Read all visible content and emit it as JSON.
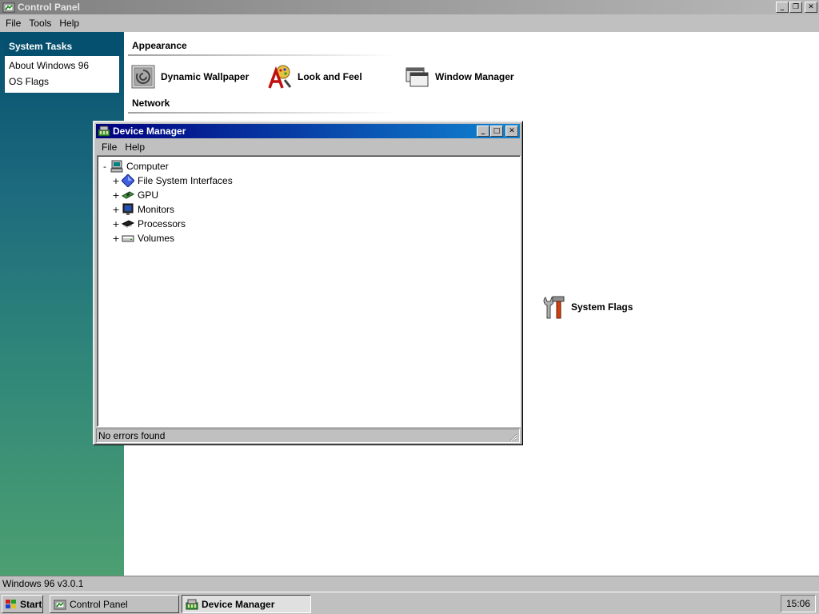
{
  "control_panel": {
    "title": "Control Panel",
    "menu": [
      "File",
      "Tools",
      "Help"
    ],
    "title_buttons": {
      "minimize": "_",
      "restore": "❐",
      "close": "✕"
    },
    "status_text": "Windows 96 v3.0.1"
  },
  "sidebar": {
    "header": "System Tasks",
    "items": [
      {
        "label": "About Windows 96"
      },
      {
        "label": "OS Flags"
      }
    ]
  },
  "sections": {
    "appearance": {
      "heading": "Appearance",
      "applets": [
        {
          "label": "Dynamic Wallpaper",
          "icon": "wallpaper-icon"
        },
        {
          "label": "Look and Feel",
          "icon": "look-and-feel-icon"
        },
        {
          "label": "Window Manager",
          "icon": "window-manager-icon"
        }
      ]
    },
    "network": {
      "heading": "Network"
    },
    "system": {
      "applets": [
        {
          "label": "System Flags",
          "icon": "tools-icon"
        }
      ]
    }
  },
  "device_manager": {
    "title": "Device Manager",
    "menu": [
      "File",
      "Help"
    ],
    "title_buttons": {
      "minimize": "_",
      "maximize": "□",
      "close": "✕"
    },
    "tree": {
      "root": {
        "label": "Computer",
        "expander": "-"
      },
      "children": [
        {
          "label": "File System Interfaces",
          "expander": "+",
          "icon": "filesystem-icon"
        },
        {
          "label": "GPU",
          "expander": "+",
          "icon": "gpu-icon"
        },
        {
          "label": "Monitors",
          "expander": "+",
          "icon": "monitor-icon"
        },
        {
          "label": "Processors",
          "expander": "+",
          "icon": "processor-icon"
        },
        {
          "label": "Volumes",
          "expander": "+",
          "icon": "volume-icon"
        }
      ]
    },
    "status_text": "No errors found"
  },
  "taskbar": {
    "start_label": "Start",
    "tasks": [
      {
        "label": "Control Panel",
        "active": false
      },
      {
        "label": "Device Manager",
        "active": true
      }
    ],
    "clock": "15:06"
  },
  "colors": {
    "sidebar_header": "#05506f",
    "sidebar_gradient_bottom": "#4c9f71",
    "active_title": "#000080",
    "inactive_title": "#808080",
    "face": "#c0c0c0"
  }
}
